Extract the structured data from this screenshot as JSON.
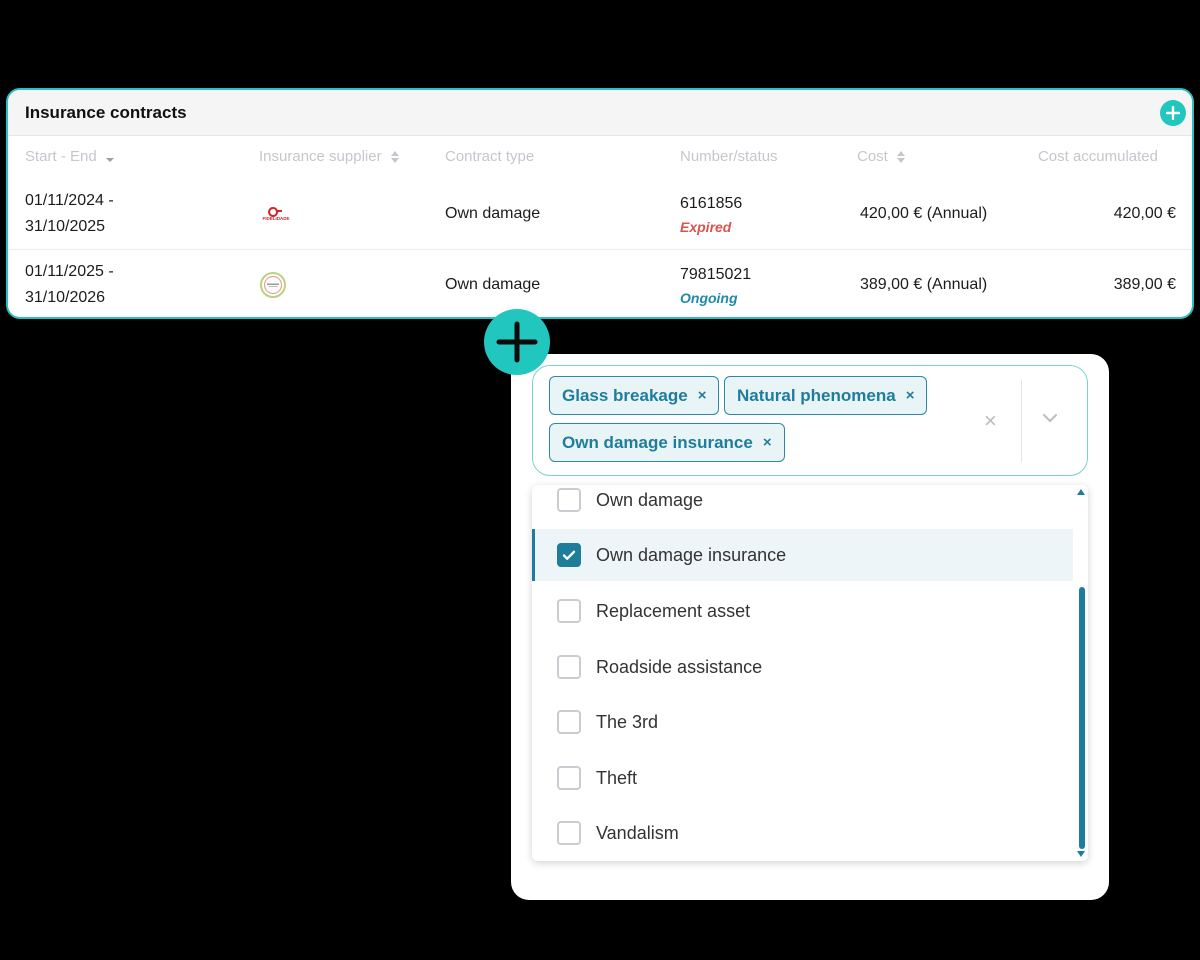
{
  "contracts": {
    "title": "Insurance contracts",
    "columns": {
      "start_end": "Start - End",
      "supplier": "Insurance supplier",
      "contract_type": "Contract type",
      "number_status": "Number/status",
      "cost": "Cost",
      "cost_accumulated": "Cost accumulated"
    },
    "rows": [
      {
        "start": "01/11/2024 -",
        "end": "31/10/2025",
        "supplier_logo_text": "FIDELIDADE",
        "contract_type": "Own damage",
        "number": "6161856",
        "status": "Expired",
        "cost": "420,00 € (Annual)",
        "cost_accumulated": "420,00 €"
      },
      {
        "start": "01/11/2025 -",
        "end": "31/10/2026",
        "supplier_logo_text": "",
        "contract_type": "Own damage",
        "number": "79815021",
        "status": "Ongoing",
        "cost": "389,00 € (Annual)",
        "cost_accumulated": "389,00 €"
      }
    ]
  },
  "multiselect": {
    "selected_tags": [
      "Glass breakage",
      "Natural phenomena",
      "Own damage insurance"
    ],
    "tag_remove_glyph": "×",
    "clear_glyph": "×",
    "options": [
      {
        "label": "Own damage",
        "checked": false
      },
      {
        "label": "Own damage insurance",
        "checked": true
      },
      {
        "label": "Replacement asset",
        "checked": false
      },
      {
        "label": "Roadside assistance",
        "checked": false
      },
      {
        "label": "The 3rd",
        "checked": false
      },
      {
        "label": "Theft",
        "checked": false
      },
      {
        "label": "Vandalism",
        "checked": false
      }
    ]
  },
  "colors": {
    "accent_teal": "#21c6be",
    "primary_blue": "#1f7d9c",
    "expired_red": "#d9534f",
    "ongoing_blue": "#1f8aa8"
  },
  "icons": {
    "add_contract": "plus-circle-icon",
    "sort": "sort-arrows-icon",
    "dropdown": "chevron-down-icon",
    "checkbox_checked": "check-icon"
  }
}
